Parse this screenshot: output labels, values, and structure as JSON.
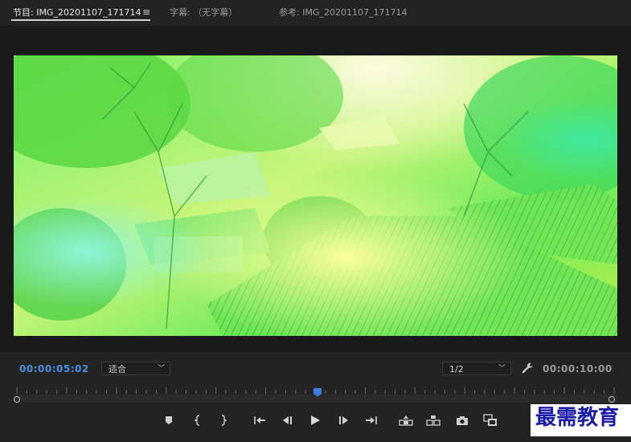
{
  "tabs": [
    {
      "label": "节目: IMG_20201107_171714",
      "active": true
    },
    {
      "label": "字幕: （无字幕）",
      "active": false
    },
    {
      "label": "参考: IMG_20201107_171714",
      "active": false
    }
  ],
  "monitor": {
    "current_time": "00:00:05:02",
    "duration": "00:00:10:00",
    "zoom_select": "适合",
    "resolution_select": "1/2",
    "playhead_position_fraction": 0.503
  },
  "icons": {
    "menu": "hamburger-menu-icon",
    "settings": "wrench-icon",
    "transport": [
      "add-marker-icon",
      "mark-in-icon",
      "mark-out-icon",
      "go-to-in-icon",
      "step-back-icon",
      "play-icon",
      "step-forward-icon",
      "go-to-out-icon",
      "lift-icon",
      "extract-icon",
      "export-frame-icon",
      "comparison-view-icon"
    ]
  },
  "colors": {
    "timecode_current": "#4a90e2",
    "timecode_duration": "#9a9a9a",
    "background": "#232323",
    "watermark": "#1a1aa8"
  },
  "watermark": {
    "text": "最需教育"
  }
}
